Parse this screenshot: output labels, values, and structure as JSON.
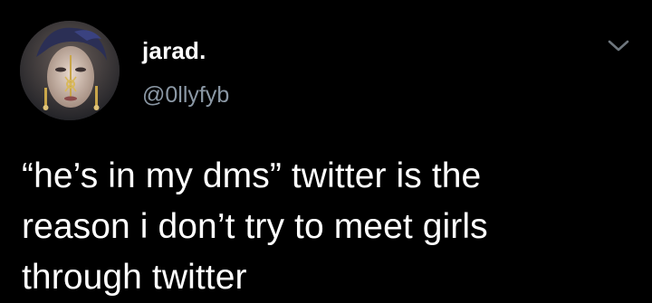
{
  "tweet": {
    "display_name": "jarad.",
    "handle": "@0llyfyb",
    "text_lines": [
      "“he’s in my dms” twitter is the",
      "reason i don’t try to meet girls",
      "through twitter"
    ],
    "menu_icon": "chevron-down-icon",
    "avatar_icon": "avatar"
  },
  "colors": {
    "background": "#000000",
    "text": "#ffffff",
    "secondary_text": "#8b98a5",
    "chevron": "#6e767d"
  }
}
